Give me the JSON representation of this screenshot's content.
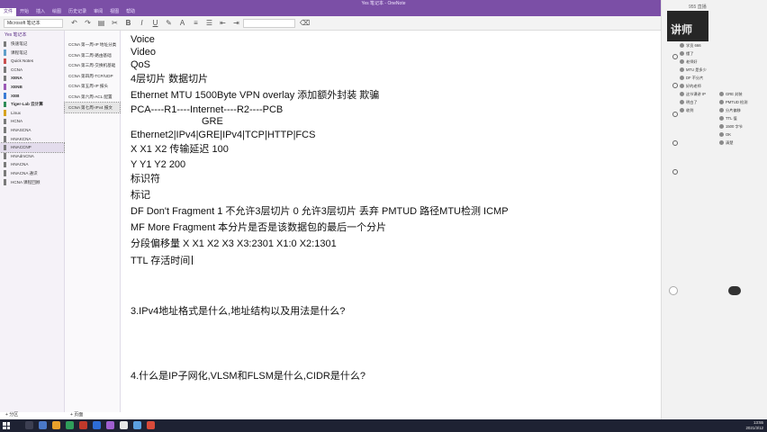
{
  "window": {
    "title": "Yes 笔记本 - OneNote",
    "controls": [
      "—",
      "▢",
      "✕"
    ],
    "ribbon_tabs": [
      "文件",
      "开始",
      "插入",
      "绘图",
      "历史记录",
      "审阅",
      "视图",
      "帮助"
    ]
  },
  "toolbar": {
    "notebook_name": "Microsoft 笔记本"
  },
  "sections": {
    "header": "Yes 笔记本",
    "items": [
      {
        "label": "快速笔记",
        "color": "#7a7a7a",
        "bold": false
      },
      {
        "label": "课程笔记",
        "color": "#5f9ec9",
        "bold": false
      },
      {
        "label": "Quick Notes",
        "color": "#c94f4f",
        "bold": false
      },
      {
        "label": "CCNA",
        "color": "#7a7a7a",
        "bold": false
      },
      {
        "label": "XENA",
        "color": "#7a7a7a",
        "bold": true
      },
      {
        "label": "XENB",
        "color": "#9b59b6",
        "bold": true
      },
      {
        "label": "XEB",
        "color": "#3a7bd5",
        "bold": true
      },
      {
        "label": "Tiger-Lab 云计算",
        "color": "#2e8b57",
        "bold": true
      },
      {
        "label": "Linux",
        "color": "#d6a21e",
        "bold": false
      },
      {
        "label": "HCNA",
        "color": "#7a7a7a",
        "bold": false
      },
      {
        "label": "HNASCNA",
        "color": "#7a7a7a",
        "bold": false
      },
      {
        "label": "HNAKCNA",
        "color": "#7a7a7a",
        "bold": false
      },
      {
        "label": "HNACCNP",
        "color": "#7a7a7a",
        "bold": false
      },
      {
        "label": "HNAdmCNA",
        "color": "#7a7a7a",
        "bold": false
      },
      {
        "label": "HNACNA",
        "color": "#7a7a7a",
        "bold": false
      },
      {
        "label": "HNACNA 通识",
        "color": "#7a7a7a",
        "bold": false
      },
      {
        "label": "HCNA 课程回顾",
        "color": "#7a7a7a",
        "bold": false
      }
    ],
    "selected_index": 12
  },
  "pages": {
    "items": [
      "CCNA 第一周-IP 地址分类",
      "CCNA 第二周-路由基础",
      "CCNA 第三周-交换机基础",
      "CCNA 第四周-TCP/UDP",
      "CCNA 第五周-IP 报头",
      "CCNA 第六周-ACL 配置",
      "CCNA 第七周-IPv4 报文"
    ],
    "selected_index": 6
  },
  "bottom_bar": {
    "add_section": "+ 分区",
    "add_page": "+ 页面"
  },
  "note": {
    "lines": [
      "Voice",
      "Video",
      "QoS",
      "4层切片 数据切片",
      "Ethernet MTU 1500Byte  VPN overlay 添加额外封装 欺骗",
      "PCA----R1----Internet----R2----PCB",
      "GRE",
      "Ethernet2|IPv4|GRE|IPv4|TCP|HTTP|FCS",
      "X X1 X2  传输延迟 100",
      "Y Y1 Y2   200",
      "标识符",
      "标记",
      "DF  Don't Fragment  1 不允许3层切片  0 允许3层切片 丢弃 PMTUD 路径MTU检测 ICMP",
      "MF More Fragment 本分片是否是该数据包的最后一个分片",
      "分段偏移量 X X1 X2 X3     X3:2301 X1:0 X2:1301",
      "TTL 存活时间",
      "3.IPv4地址格式是什么,地址结构以及用法是什么?",
      "4.什么是IP子网化,VLSM和FLSM是什么,CIDR是什么?"
    ]
  },
  "right_panel": {
    "header": "955 直播",
    "video_label": "讲师",
    "messages": [
      "学员 666",
      "懂了",
      "老师好",
      "MTU 是多少",
      "DF 不分片",
      "好的老师",
      "这节课讲 IP",
      "明白了",
      "收到"
    ],
    "messages2": [
      "GRE 封装",
      "PMTUD 检测",
      "分片偏移",
      "TTL 值",
      "1500 字节",
      "OK",
      "清楚"
    ]
  },
  "taskbar": {
    "time": "13:55",
    "date": "2021/3/12"
  }
}
